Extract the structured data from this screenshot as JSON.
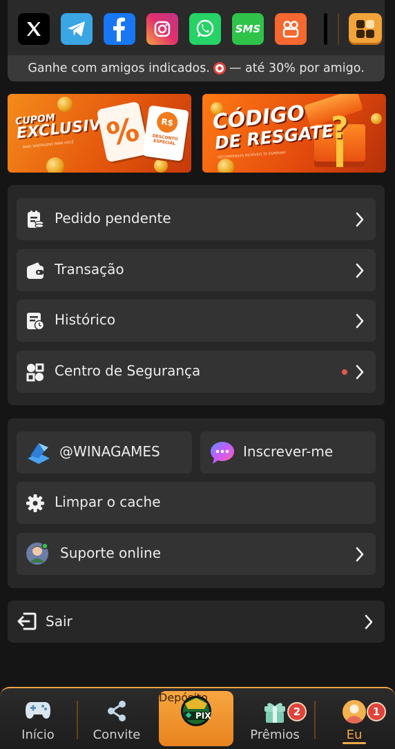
{
  "share": {
    "icons": [
      {
        "name": "x-icon",
        "label": ""
      },
      {
        "name": "telegram-icon",
        "label": ""
      },
      {
        "name": "facebook-icon",
        "label": ""
      },
      {
        "name": "instagram-icon",
        "label": ""
      },
      {
        "name": "whatsapp-icon",
        "label": ""
      },
      {
        "name": "sms-icon",
        "label": "SMS"
      },
      {
        "name": "kwai-icon",
        "label": ""
      }
    ],
    "text_before": "Ganhe com amigos indicados.",
    "text_after": "— até 30% por amigo."
  },
  "banners": {
    "cupom": {
      "title_line1": "CUPOM",
      "title_line2": "EXCLUSIVO",
      "subtitle": "MAIS VANTAGENS PARA VOCÊ",
      "percent": "%",
      "ticket_currency": "R$",
      "ticket_text": "DESCONTO ESPECIAL"
    },
    "codigo": {
      "title_line1": "CÓDIGO",
      "title_line2": "DE RESGATE",
      "subtitle": "RECOMPENSAS INCRÍVEIS TE ESPERAM!",
      "gift_symbol": "?"
    }
  },
  "menu": {
    "pedido": "Pedido pendente",
    "transacao": "Transação",
    "historico": "Histórico",
    "seguranca": "Centro de Segurança"
  },
  "social_menu": {
    "channel": "@WINAGAMES",
    "subscribe": "Inscrever-me",
    "cache": "Limpar o cache",
    "support": "Suporte online"
  },
  "logout": "Sair",
  "tabs": {
    "inicio": "Início",
    "convite": "Convite",
    "deposito": "Depósito",
    "deposito_badge": "PIX",
    "premios": "Prêmios",
    "premios_badge": "2",
    "eu": "Eu",
    "eu_badge": "1"
  },
  "colors": {
    "accent": "#f4a948",
    "background": "#151515",
    "card": "#272727",
    "row": "#333333",
    "alert_dot": "#e05a4e"
  }
}
